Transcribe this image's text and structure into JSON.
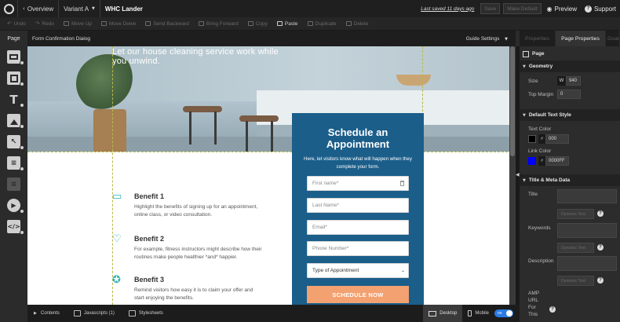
{
  "topbar": {
    "overview_label": "Overview",
    "variant_label": "Variant A",
    "page_name": "WHC Lander",
    "last_saved": "Last saved 11 days ago",
    "save_label": "Save",
    "make_default_label": "Make Default",
    "preview_label": "Preview",
    "support_label": "Support"
  },
  "toolbar": {
    "undo": "Undo",
    "redo": "Redo",
    "move_up": "Move Up",
    "move_down": "Move Down",
    "send_backward": "Send Backward",
    "bring_forward": "Bring Forward",
    "copy": "Copy",
    "paste": "Paste",
    "duplicate": "Duplicate",
    "delete": "Delete"
  },
  "left_panel": {
    "tab_label": "Page"
  },
  "canvas_header": {
    "title": "Form Confirmation Dialog",
    "guide_settings": "Guide Settings"
  },
  "hero": {
    "headline": "Let our house cleaning service work while you unwind."
  },
  "benefits": [
    {
      "title": "Benefit 1",
      "desc": "Highlight the benefits of signing up for an appointment, online class, or video consultation.",
      "icon": "monitor-icon"
    },
    {
      "title": "Benefit 2",
      "desc": "For example, fitness instructors might describe how their routines make people healthier *and* happier.",
      "icon": "heart-icon"
    },
    {
      "title": "Benefit 3",
      "desc": "Remind visitors how easy it is to claim your offer and start enjoying the benefits.",
      "icon": "award-icon"
    }
  ],
  "form": {
    "title_line1": "Schedule an",
    "title_line2": "Appointment",
    "subtitle": "Here, let visitors know what will happen when they complete your form.",
    "first_name": "First name*",
    "last_name": "Last Name*",
    "email": "Email*",
    "phone": "Phone Number*",
    "appointment_type": "Type of Appointment",
    "submit": "SCHEDULE NOW",
    "color": "#1b5e8a",
    "button_color": "#f3a170"
  },
  "right_panel": {
    "tabs": [
      "Properties",
      "Page Properties",
      "Goals"
    ],
    "page_title": "Page",
    "geometry": {
      "heading": "Geometry",
      "size_label": "Size",
      "width_badge": "W",
      "width_value": "940",
      "top_margin_label": "Top Margin",
      "top_margin_value": "0"
    },
    "default_text_style": {
      "heading": "Default Text Style",
      "text_color_label": "Text Color",
      "text_color_value": "000",
      "text_color": "#000000",
      "link_color_label": "Link Color",
      "link_color_value": "0000FF",
      "link_color": "#0000ff",
      "hash": "#"
    },
    "meta": {
      "heading": "Title & Meta Data",
      "title_label": "Title",
      "keywords_label": "Keywords",
      "description_label": "Description",
      "amp_label_1": "AMP",
      "amp_label_2": "URL",
      "amp_label_3": "For",
      "amp_label_4": "This",
      "dynamic_text": "Dynamic Text",
      "help": "?"
    }
  },
  "bottombar": {
    "contents": "Contents",
    "javascripts": "Javascripts (1)",
    "stylesheets": "Stylesheets",
    "desktop": "Desktop",
    "mobile": "Mobile",
    "toggle": "on"
  }
}
